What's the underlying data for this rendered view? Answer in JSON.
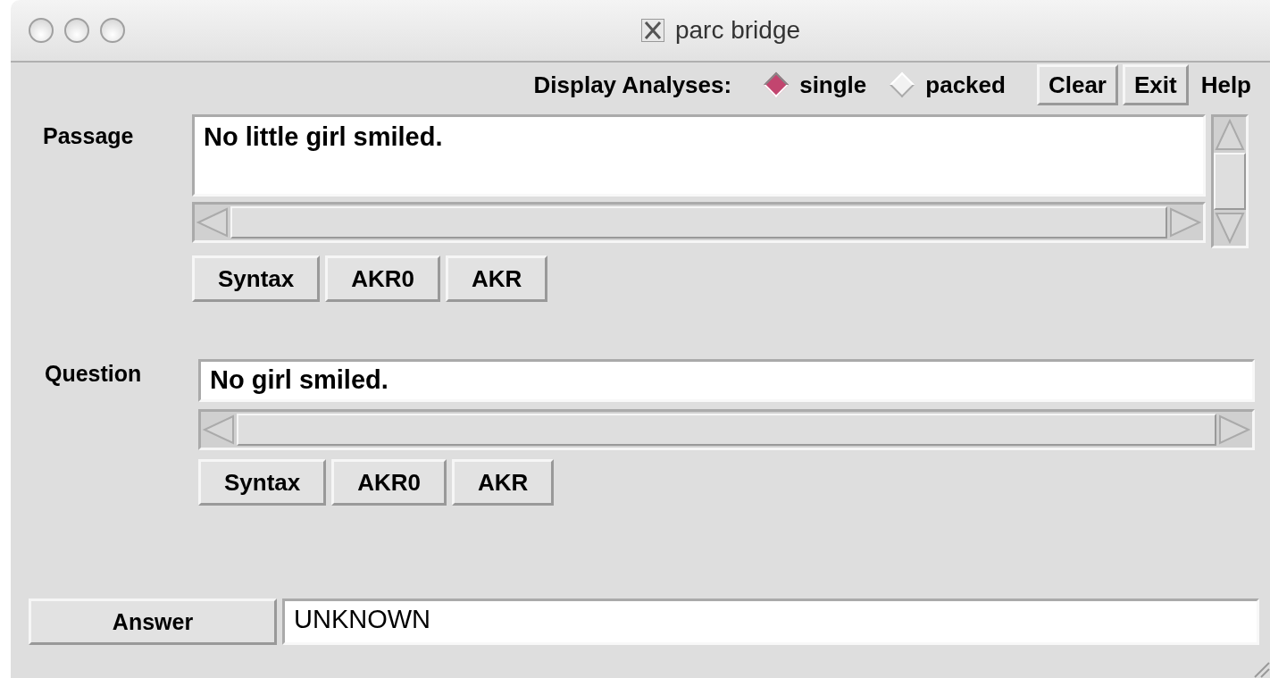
{
  "window": {
    "title": "parc bridge"
  },
  "display_analyses": {
    "label": "Display Analyses:",
    "options": [
      {
        "label": "single",
        "selected": true
      },
      {
        "label": "packed",
        "selected": false
      }
    ]
  },
  "toolbar_buttons": [
    {
      "label": "Clear",
      "kind": "raised"
    },
    {
      "label": "Exit",
      "kind": "raised"
    },
    {
      "label": "Help",
      "kind": "flat"
    }
  ],
  "passage": {
    "label": "Passage",
    "value": "No little girl smiled.",
    "buttons": [
      "Syntax",
      "AKR0",
      "AKR"
    ]
  },
  "question": {
    "label": "Question",
    "value": "No girl smiled.",
    "buttons": [
      "Syntax",
      "AKR0",
      "AKR"
    ]
  },
  "answer": {
    "button": "Answer",
    "value": "UNKNOWN"
  }
}
